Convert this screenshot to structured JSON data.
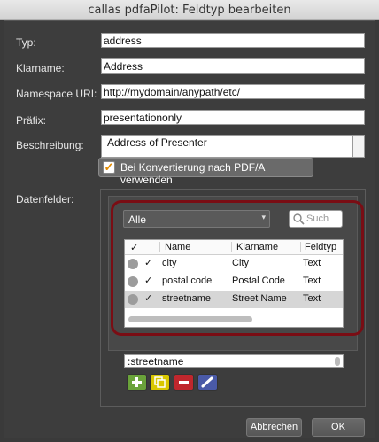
{
  "window": {
    "title": "callas pdfaPilot: Feldtyp bearbeiten"
  },
  "form": {
    "typ": {
      "label": "Typ:",
      "value": "address"
    },
    "klarname": {
      "label": "Klarname:",
      "value": "Address"
    },
    "namespace": {
      "label": "Namespace URI:",
      "value": "http://mydomain/anypath/etc/"
    },
    "praefix": {
      "label": "Präfix:",
      "value": "presentationonly"
    },
    "beschreibung": {
      "label": "Beschreibung:",
      "value": "Address of Presenter"
    },
    "convert_checkbox": {
      "label": "Bei Konvertierung nach PDF/A verwenden",
      "checked": true,
      "mark": "✓"
    },
    "datenfelder": {
      "label": "Datenfelder:"
    }
  },
  "fields_panel": {
    "filter": {
      "selected": "Alle",
      "arrow": "▾"
    },
    "search": {
      "placeholder": "Such"
    },
    "columns": {
      "check": "✓",
      "name": "Name",
      "klarname": "Klarname",
      "feldtyp": "Feldtyp"
    },
    "rows": [
      {
        "check": "✓",
        "name": "city",
        "klarname": "City",
        "feldtyp": "Text",
        "selected": false
      },
      {
        "check": "✓",
        "name": "postal code",
        "klarname": "Postal Code",
        "feldtyp": "Text",
        "selected": false
      },
      {
        "check": "✓",
        "name": "streetname",
        "klarname": "Street Name",
        "feldtyp": "Text",
        "selected": true
      }
    ],
    "path_value": ":streetname",
    "toolbar": [
      {
        "name": "add-icon",
        "color": "#6aa33a"
      },
      {
        "name": "duplicate-icon",
        "color": "#d9c700"
      },
      {
        "name": "remove-icon",
        "color": "#c0272d"
      },
      {
        "name": "edit-icon",
        "color": "#4a5aa8"
      }
    ]
  },
  "buttons": {
    "cancel": "Abbrechen",
    "ok": "OK"
  },
  "colors": {
    "highlight_ring": "#7a0d14",
    "check_accent": "#e28a00"
  }
}
